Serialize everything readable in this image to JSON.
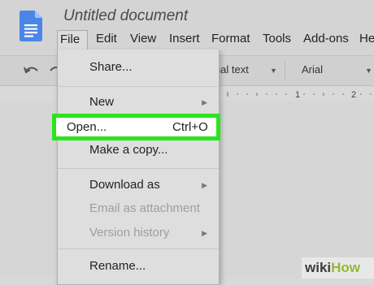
{
  "document": {
    "title": "Untitled document"
  },
  "menubar": {
    "items": [
      "File",
      "Edit",
      "View",
      "Insert",
      "Format",
      "Tools",
      "Add-ons",
      "He"
    ]
  },
  "toolbar": {
    "style_value": "rmal text",
    "font_value": "Arial",
    "ruler_marks": [
      "1",
      "2"
    ]
  },
  "file_menu": {
    "share": "Share...",
    "new": "New",
    "open": "Open...",
    "open_shortcut": "Ctrl+O",
    "make_copy": "Make a copy...",
    "download_as": "Download as",
    "email_attachment": "Email as attachment",
    "version_history": "Version history",
    "rename": "Rename..."
  },
  "watermark": {
    "wiki": "wiki",
    "how": "How"
  },
  "colors": {
    "highlight": "#29e61c",
    "docs_blue": "#4a86e8"
  }
}
